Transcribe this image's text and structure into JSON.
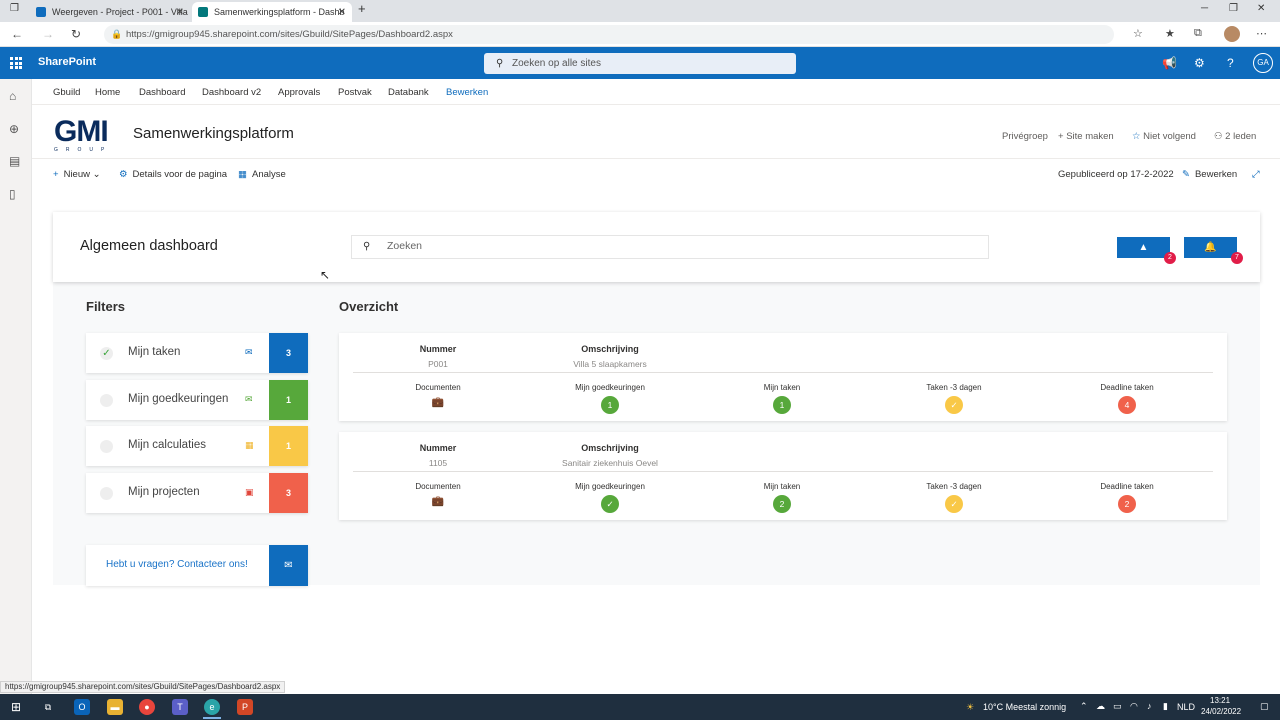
{
  "browser": {
    "tabs": [
      {
        "title": "Weergeven - Project - P001 - Villa",
        "active": false
      },
      {
        "title": "Samenwerkingsplatform - Dashb",
        "active": true
      }
    ],
    "url": "https://gmigroup945.sharepoint.com/sites/Gbuild/SitePages/Dashboard2.aspx",
    "status_url": "https://gmigroup945.sharepoint.com/sites/Gbuild/SitePages/Dashboard2.aspx"
  },
  "suitebar": {
    "app_name": "SharePoint",
    "search_placeholder": "Zoeken op alle sites",
    "user_initials": "GA"
  },
  "sitenav": {
    "items": [
      "Gbuild",
      "Home",
      "Dashboard",
      "Dashboard v2",
      "Approvals",
      "Postvak",
      "Databank",
      "Bewerken"
    ]
  },
  "siteheader": {
    "logo_text": "GMI",
    "logo_sub": "GROUP",
    "title": "Samenwerkingsplatform",
    "privacy": "Privégroep",
    "site_make": "Site maken",
    "follow": "Niet volgend",
    "members": "2 leden"
  },
  "commandbar": {
    "new": "Nieuw",
    "details": "Details voor de pagina",
    "analysis": "Analyse",
    "published": "Gepubliceerd op 17-2-2022",
    "edit": "Bewerken"
  },
  "dashboard": {
    "title": "Algemeen dashboard",
    "search_placeholder": "Zoeken",
    "alerts": [
      {
        "icon": "warning-icon",
        "count": "2"
      },
      {
        "icon": "bell-icon",
        "count": "7"
      }
    ],
    "filters_heading": "Filters",
    "overview_heading": "Overzicht",
    "filters": [
      {
        "label": "Mijn taken",
        "count": "3",
        "color": "#0f6cbd",
        "icon_color": "#0f6cbd",
        "checked": true
      },
      {
        "label": "Mijn goedkeuringen",
        "count": "1",
        "color": "#57a83b",
        "icon_color": "#57a83b",
        "checked": false
      },
      {
        "label": "Mijn calculaties",
        "count": "1",
        "color": "#f9c847",
        "icon_color": "#f0b429",
        "checked": false
      },
      {
        "label": "Mijn projecten",
        "count": "3",
        "color": "#f0614b",
        "icon_color": "#e0453a",
        "checked": false
      }
    ],
    "contact": "Hebt u vragen? Contacteer ons!",
    "projects": [
      {
        "nummer_label": "Nummer",
        "nummer": "P001",
        "omschrijving_label": "Omschrijving",
        "omschrijving": "Villa 5 slaapkamers",
        "metrics": {
          "documenten_label": "Documenten",
          "goedkeuringen_label": "Mijn goedkeuringen",
          "goedkeuringen": "1",
          "taken_label": "Mijn taken",
          "taken": "1",
          "taken3_label": "Taken -3 dagen",
          "taken3": "✓",
          "deadline_label": "Deadline taken",
          "deadline": "4"
        }
      },
      {
        "nummer_label": "Nummer",
        "nummer": "1105",
        "omschrijving_label": "Omschrijving",
        "omschrijving": "Sanitair ziekenhuis Oevel",
        "metrics": {
          "documenten_label": "Documenten",
          "goedkeuringen_label": "Mijn goedkeuringen",
          "goedkeuringen": "✓",
          "taken_label": "Mijn taken",
          "taken": "2",
          "taken3_label": "Taken -3 dagen",
          "taken3": "✓",
          "deadline_label": "Deadline taken",
          "deadline": "2"
        }
      }
    ],
    "colors": {
      "green": "#57a83b",
      "yellow": "#f9c847",
      "red": "#f0614b",
      "blue": "#0f6cbd"
    }
  },
  "taskbar": {
    "weather": "10°C  Meestal zonnig",
    "language": "NLD",
    "time": "13:21",
    "date": "24/02/2022"
  }
}
